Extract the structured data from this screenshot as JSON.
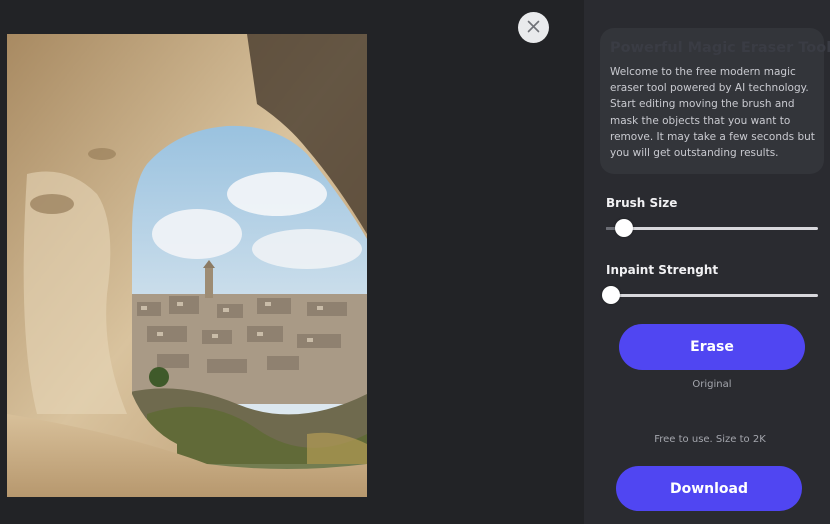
{
  "close": {
    "icon": "close-icon"
  },
  "photo": {
    "description_icon": "image"
  },
  "panel": {
    "title": "Powerful Magic Eraser Tool",
    "description": "Welcome to the free modern magic eraser tool powered by AI technology. Start editing moving the brush and mask the objects that you want to remove. It may take a few seconds but you will get outstanding results."
  },
  "brush": {
    "label": "Brush Size",
    "level": 0.08
  },
  "inpaint": {
    "label": "Inpaint Strenght",
    "level": 0.0
  },
  "erase": {
    "label": "Erase"
  },
  "original": {
    "label": "Original"
  },
  "note": {
    "text": "Free to use. Size to 2K"
  },
  "download": {
    "label": "Download"
  },
  "colors": {
    "accent": "#5046f2",
    "panel": "#2a2b30",
    "background": "#222326"
  }
}
